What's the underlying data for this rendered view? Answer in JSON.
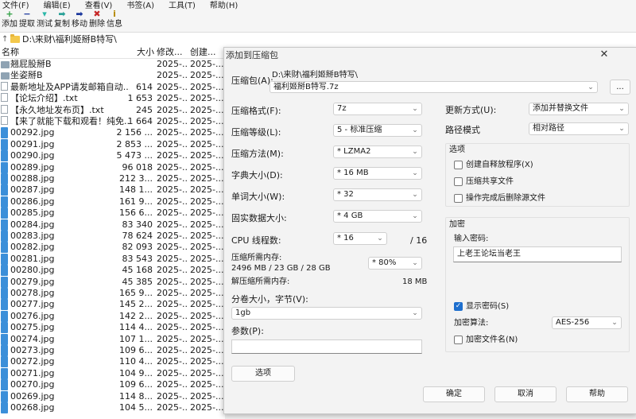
{
  "menu": [
    "文件(F)",
    "编辑(E)",
    "查看(V)",
    "书签(A)",
    "工具(T)",
    "帮助(H)"
  ],
  "toolbar": [
    {
      "label": "添加",
      "icon": "plus-icon",
      "glyph": "+",
      "color": "#2ea043"
    },
    {
      "label": "提取",
      "icon": "minus-icon",
      "glyph": "−",
      "color": "#1e3a9e"
    },
    {
      "label": "测试",
      "icon": "check-icon",
      "glyph": "▾",
      "color": "#2bb7a8"
    },
    {
      "label": "复制",
      "icon": "copy-arrow-icon",
      "glyph": "➡",
      "color": "#2aa198"
    },
    {
      "label": "移动",
      "icon": "move-arrow-icon",
      "glyph": "➡",
      "color": "#1e3a9e"
    },
    {
      "label": "删除",
      "icon": "delete-icon",
      "glyph": "✖",
      "color": "#c62828"
    },
    {
      "label": "信息",
      "icon": "info-icon",
      "glyph": "i",
      "color": "#b58900"
    }
  ],
  "address": {
    "path": "D:\\来财\\福利姬掰B特写\\"
  },
  "filelist": {
    "headers": {
      "name": "名称",
      "size": "大小",
      "modified": "修改...",
      "created": "创建..."
    },
    "rows": [
      {
        "type": "folder",
        "name": "翘屁股掰B",
        "size": "",
        "modified": "2025-...",
        "created": "2025-..."
      },
      {
        "type": "folder",
        "name": "坐姿掰B",
        "size": "",
        "modified": "2025-...",
        "created": "2025-..."
      },
      {
        "type": "doc",
        "name": "最新地址及APP请发邮箱自动...",
        "size": "614",
        "modified": "2025-...",
        "created": "2025-..."
      },
      {
        "type": "doc",
        "name": "【论坛介绍】.txt",
        "size": "1 653",
        "modified": "2025-...",
        "created": "2025-..."
      },
      {
        "type": "doc",
        "name": "【永久地址发布页】.txt",
        "size": "245",
        "modified": "2025-...",
        "created": "2025-..."
      },
      {
        "type": "doc",
        "name": "【来了就能下载和观看！纯免...",
        "size": "1 664",
        "modified": "2025-...",
        "created": "2025-..."
      },
      {
        "type": "img",
        "name": "00292.jpg",
        "size": "2 156 ...",
        "modified": "2025-...",
        "created": "2025-..."
      },
      {
        "type": "img",
        "name": "00291.jpg",
        "size": "2 853 ...",
        "modified": "2025-...",
        "created": "2025-..."
      },
      {
        "type": "img",
        "name": "00290.jpg",
        "size": "5 473 ...",
        "modified": "2025-...",
        "created": "2025-..."
      },
      {
        "type": "img",
        "name": "00289.jpg",
        "size": "96 018",
        "modified": "2025-...",
        "created": "2025-..."
      },
      {
        "type": "img",
        "name": "00288.jpg",
        "size": "212 3...",
        "modified": "2025-...",
        "created": "2025-..."
      },
      {
        "type": "img",
        "name": "00287.jpg",
        "size": "148 1...",
        "modified": "2025-...",
        "created": "2025-..."
      },
      {
        "type": "img",
        "name": "00286.jpg",
        "size": "161 9...",
        "modified": "2025-...",
        "created": "2025-..."
      },
      {
        "type": "img",
        "name": "00285.jpg",
        "size": "156 6...",
        "modified": "2025-...",
        "created": "2025-..."
      },
      {
        "type": "img",
        "name": "00284.jpg",
        "size": "83 340",
        "modified": "2025-...",
        "created": "2025-..."
      },
      {
        "type": "img",
        "name": "00283.jpg",
        "size": "78 624",
        "modified": "2025-...",
        "created": "2025-..."
      },
      {
        "type": "img",
        "name": "00282.jpg",
        "size": "82 093",
        "modified": "2025-...",
        "created": "2025-..."
      },
      {
        "type": "img",
        "name": "00281.jpg",
        "size": "83 543",
        "modified": "2025-...",
        "created": "2025-..."
      },
      {
        "type": "img",
        "name": "00280.jpg",
        "size": "45 168",
        "modified": "2025-...",
        "created": "2025-..."
      },
      {
        "type": "img",
        "name": "00279.jpg",
        "size": "45 385",
        "modified": "2025-...",
        "created": "2025-..."
      },
      {
        "type": "img",
        "name": "00278.jpg",
        "size": "165 9...",
        "modified": "2025-...",
        "created": "2025-..."
      },
      {
        "type": "img",
        "name": "00277.jpg",
        "size": "145 2...",
        "modified": "2025-...",
        "created": "2025-..."
      },
      {
        "type": "img",
        "name": "00276.jpg",
        "size": "142 2...",
        "modified": "2025-...",
        "created": "2025-..."
      },
      {
        "type": "img",
        "name": "00275.jpg",
        "size": "114 4...",
        "modified": "2025-...",
        "created": "2025-..."
      },
      {
        "type": "img",
        "name": "00274.jpg",
        "size": "107 1...",
        "modified": "2025-...",
        "created": "2025-..."
      },
      {
        "type": "img",
        "name": "00273.jpg",
        "size": "109 6...",
        "modified": "2025-...",
        "created": "2025-..."
      },
      {
        "type": "img",
        "name": "00272.jpg",
        "size": "110 4...",
        "modified": "2025-...",
        "created": "2025-..."
      },
      {
        "type": "img",
        "name": "00271.jpg",
        "size": "104 9...",
        "modified": "2025-...",
        "created": "2025-..."
      },
      {
        "type": "img",
        "name": "00270.jpg",
        "size": "109 6...",
        "modified": "2025-...",
        "created": "2025-..."
      },
      {
        "type": "img",
        "name": "00269.jpg",
        "size": "114 8...",
        "modified": "2025-...",
        "created": "2025-..."
      },
      {
        "type": "img",
        "name": "00268.jpg",
        "size": "104 5...",
        "modified": "2025-...",
        "created": "2025-..."
      }
    ]
  },
  "dialog": {
    "title": "添加到压缩包",
    "archive_label": "压缩包(A):",
    "archive_dir": "D:\\来财\\福利姬掰B特写\\",
    "archive_name": "福利姬掰B特写.7z",
    "browse_label": "...",
    "format_label": "压缩格式(F):",
    "format_value": "7z",
    "level_label": "压缩等级(L):",
    "level_value": "5 - 标准压缩",
    "method_label": "压缩方法(M):",
    "method_value": "*  LZMA2",
    "dict_label": "字典大小(D):",
    "dict_value": "*  16 MB",
    "word_label": "单词大小(W):",
    "word_value": "*  32",
    "solid_label": "固实数据大小:",
    "solid_value": "*  4 GB",
    "cpu_label": "CPU 线程数:",
    "cpu_value": "*  16",
    "cpu_total": "/ 16",
    "mem_comp_label": "压缩所需内存:",
    "mem_comp_value": "2496 MB / 23 GB / 28 GB",
    "mem_comp_pct": "*  80%",
    "mem_decomp_label": "解压缩所需内存:",
    "mem_decomp_value": "18 MB",
    "split_label": "分卷大小，字节(V):",
    "split_value": "1gb",
    "params_label": "参数(P):",
    "params_value": "",
    "options_button": "选项",
    "update_label": "更新方式(U):",
    "update_value": "添加并替换文件",
    "pathmode_label": "路径模式",
    "pathmode_value": "相对路径",
    "options_group": "选项",
    "opt_sfx": "创建自释放程序(X)",
    "opt_shared": "压缩共享文件",
    "opt_delete": "操作完成后删除源文件",
    "encrypt_group": "加密",
    "password_label": "输入密码:",
    "password_value": "上老王论坛当老王",
    "show_password": "显示密码(S)",
    "enc_method_label": "加密算法:",
    "enc_method_value": "AES-256",
    "encrypt_names": "加密文件名(N)",
    "ok_label": "确定",
    "cancel_label": "取消",
    "help_label": "帮助"
  }
}
